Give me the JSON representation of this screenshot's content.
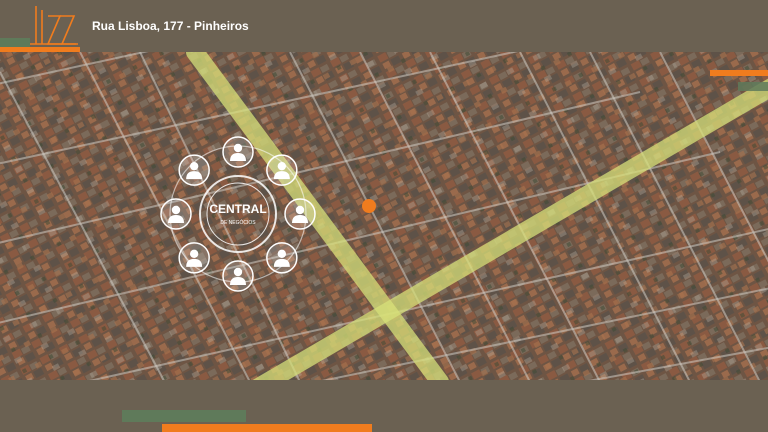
{
  "header": {
    "logo_text": "LIZZ",
    "address": "Rua Lisboa, 177 - Pinheiros"
  },
  "map": {
    "hub_label": "CENTRAL",
    "hub_sublabel": "DE NEGÓCIOS",
    "marker_color": "#f07c1e",
    "avenue_color": "#d7e07a",
    "people_icons": [
      "person-icon",
      "person-icon",
      "person-icon",
      "person-icon",
      "person-icon",
      "person-icon",
      "person-icon",
      "person-icon"
    ]
  },
  "colors": {
    "background": "#6b6152",
    "accent_orange": "#f07c1e",
    "accent_green": "#5f7a5a"
  }
}
